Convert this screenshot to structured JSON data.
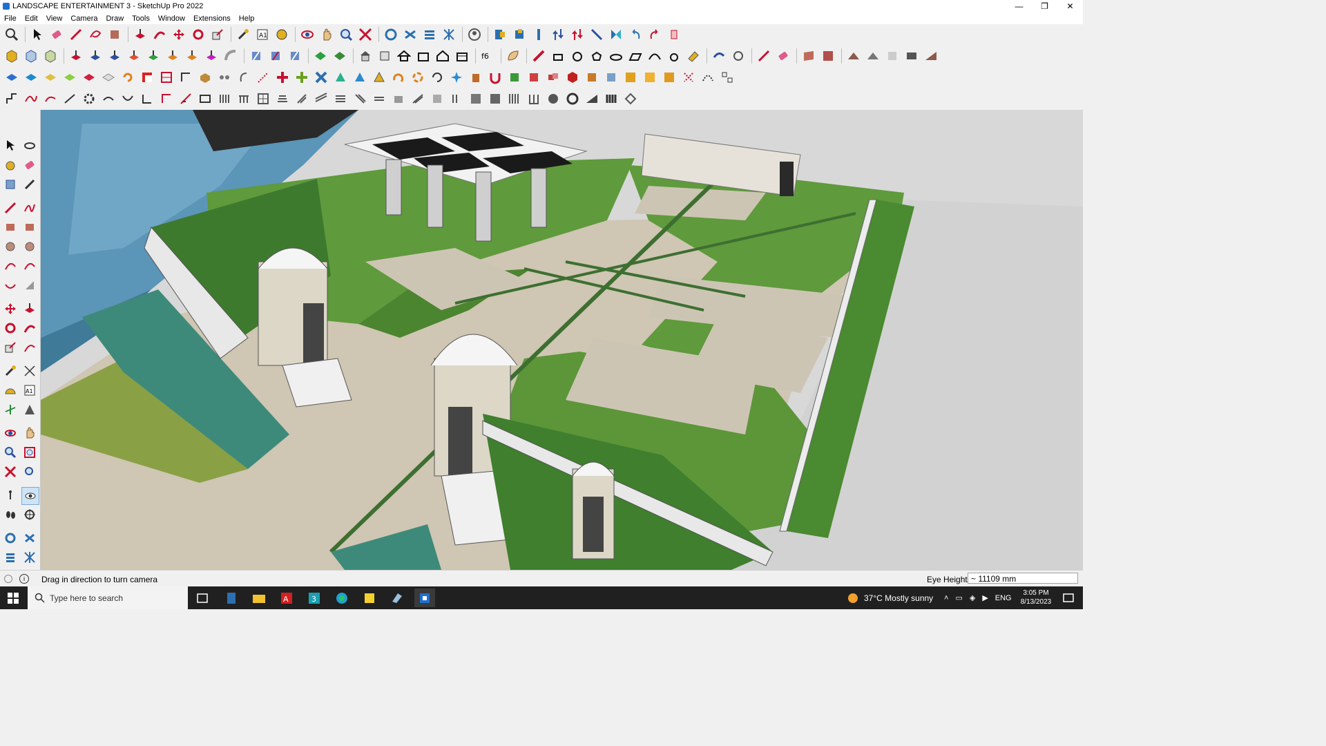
{
  "window": {
    "title": "LANDSCAPE ENTERTAINMENT 3 - SketchUp Pro 2022"
  },
  "menu": [
    "File",
    "Edit",
    "View",
    "Camera",
    "Draw",
    "Tools",
    "Window",
    "Extensions",
    "Help"
  ],
  "toolbar_icons": {
    "row1": [
      "zoom-icon",
      "select-icon",
      "eraser-icon",
      "pencil-icon",
      "lasso-icon",
      "paint-icon",
      "push-pull-icon",
      "follow-me-icon",
      "move-icon",
      "rotate-icon",
      "scale-icon",
      "tape-icon",
      "text-icon",
      "walk-icon",
      "orbit-icon",
      "pan-icon",
      "zoom-window-icon",
      "zoom-extents-icon",
      "layers-icon",
      "styles-icon",
      "outliner-icon",
      "components-icon",
      "user-icon",
      "section-icon",
      "axes-icon",
      "flip-icon",
      "undo-icon",
      "redo-icon"
    ],
    "row2": [
      "solid-icon",
      "iso-icon",
      "face-icon",
      "extrude-icon",
      "arrow-n-icon",
      "arrow-e-icon",
      "arrow-s-icon",
      "arrow-w-icon",
      "curve-icon",
      "parallel-icon",
      "frame-icon",
      "box-icon",
      "house-icon",
      "roof-icon",
      "window-icon",
      "measure-icon",
      "rectangle-icon",
      "circle-icon",
      "polygon-icon",
      "arc-icon",
      "fillet-icon",
      "mirror-icon",
      "materials-icon"
    ],
    "row3": [
      "cube-blue-icon",
      "plane-icon",
      "layer-icon",
      "slab-icon",
      "loop-icon",
      "square-red-icon",
      "grid-icon",
      "door-icon",
      "stair-icon",
      "joint-icon",
      "plus-icon",
      "snap-icon",
      "cross-icon",
      "tri-icon",
      "arch-icon",
      "spin-icon",
      "bend-icon",
      "twist-icon",
      "mesh-icon"
    ],
    "row4": [
      "line-icon",
      "spline-icon",
      "offset-icon",
      "trim-icon",
      "gear-icon",
      "curve-tool-icon",
      "array-icon",
      "fillet-2-icon",
      "stairs-icon",
      "wall-icon",
      "fence-icon",
      "railing-icon",
      "grille-icon"
    ]
  },
  "status": {
    "message": "Drag in direction to turn camera",
    "eye_height_label": "Eye Height",
    "eye_height_value": "~ 11109 mm"
  },
  "taskbar": {
    "search_placeholder": "Type here to search",
    "weather": "37°C  Mostly sunny",
    "language": "ENG",
    "time": "3:05 PM",
    "date": "8/13/2023"
  },
  "colors": {
    "lawn": "#5f9a3c",
    "paving": "#cdc6b6",
    "glass": "#4a86a8",
    "accent_toolbar": "#c8102e"
  }
}
